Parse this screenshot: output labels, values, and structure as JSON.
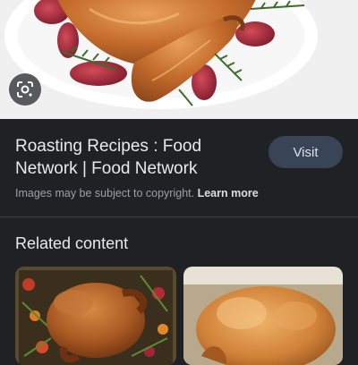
{
  "hero": {
    "image_alt": "roasted turkey on a white platter with red onions and rosemary",
    "lens_icon": "google-lens-icon"
  },
  "result": {
    "title": "Roasting Recipes : Food Network | Food Network",
    "visit_label": "Visit",
    "copyright_text": "Images may be subject to copyright.",
    "learn_more_label": "Learn more"
  },
  "related": {
    "heading": "Related content",
    "items": [
      {
        "image_alt": "roast turkey surrounded by vegetables and herbs"
      },
      {
        "image_alt": "golden roast chicken in a pan"
      }
    ]
  },
  "colors": {
    "background": "#202124",
    "visit_button": "#394457",
    "muted_text": "#9aa0a6"
  }
}
